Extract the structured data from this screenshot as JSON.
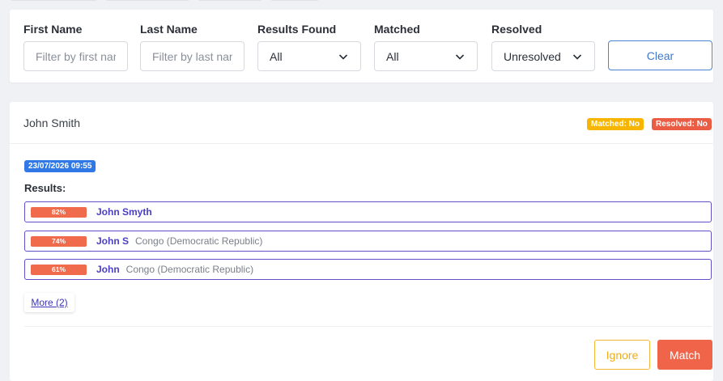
{
  "filters": {
    "first_name": {
      "label": "First Name",
      "placeholder": "Filter by first name"
    },
    "last_name": {
      "label": "Last Name",
      "placeholder": "Filter by last name"
    },
    "results_found": {
      "label": "Results Found",
      "value": "All"
    },
    "matched": {
      "label": "Matched",
      "value": "All"
    },
    "resolved": {
      "label": "Resolved",
      "value": "Unresolved"
    },
    "clear_label": "Clear"
  },
  "record": {
    "name": "John Smith",
    "matched_badge": "Matched: No",
    "resolved_badge": "Resolved: No",
    "timestamp": "23/07/2026 09:55",
    "results_label": "Results:",
    "results": [
      {
        "score": "82%",
        "name": "John Smyth",
        "country": ""
      },
      {
        "score": "74%",
        "name": "John S",
        "country": "Congo (Democratic Republic)"
      },
      {
        "score": "61%",
        "name": "John",
        "country": "Congo (Democratic Republic)"
      }
    ],
    "more_label": "More (2)",
    "ignore_label": "Ignore",
    "match_label": "Match"
  },
  "colors": {
    "accent_blue": "#2f78e6",
    "matched_badge": "#f7b500",
    "resolved_badge": "#eb5c44",
    "score_bar": "#f06a4c",
    "result_border": "#5f4fc9"
  }
}
